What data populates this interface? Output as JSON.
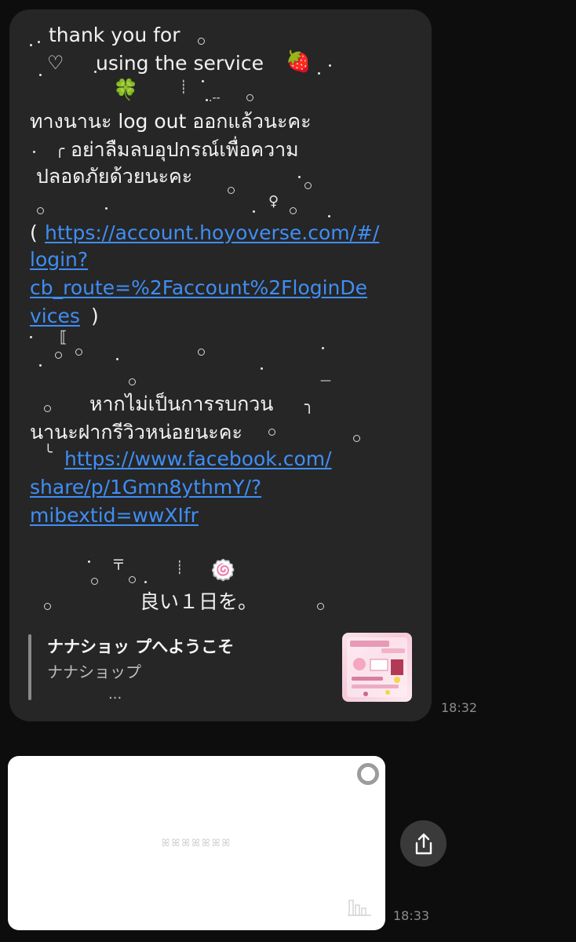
{
  "message": {
    "line1": "thank you for",
    "line2": "using the service",
    "heart": "♡",
    "strawberry": "🍓",
    "clover": "🍀",
    "thai_line1": "ทางนานะ log out ออกแล้วนะคะ",
    "thai_line2": "อย่าลืมลบอุปกรณ์เพื่อความ",
    "thai_line3": "ปลอดภัยด้วยนะคะ",
    "link1_open": "(",
    "link1_part1": "https://account.hoyoverse.com/#/",
    "link1_part2": "login?",
    "link1_part3": "cb_route=%2Faccount%2FloginDe",
    "link1_part4": "vices",
    "link1_close": ")",
    "review_line1": "หากไม่เป็นการรบกวน",
    "review_line2": "นานะฝากรีวิวหน่อยนะคะ",
    "link2_part1": "https://www.facebook.com/",
    "link2_part2": "share/p/1Gmn8ythmY/?",
    "link2_part3": "mibextid=wwXIfr",
    "fishcake": "🍥",
    "closing": "良い１日を。"
  },
  "preview": {
    "title": "ナナショッ プへようこそ",
    "subtitle": "ナナショップ",
    "more": "..."
  },
  "times": {
    "first": "18:32",
    "second": "18:33"
  },
  "card": {
    "text": "ꕤꕤꕤꕤꕤꕤꕤ"
  },
  "icons": {
    "share": "share-icon",
    "heart": "heart-icon",
    "strawberry": "strawberry-icon",
    "clover": "clover-icon",
    "fishcake": "fishcake-icon"
  }
}
